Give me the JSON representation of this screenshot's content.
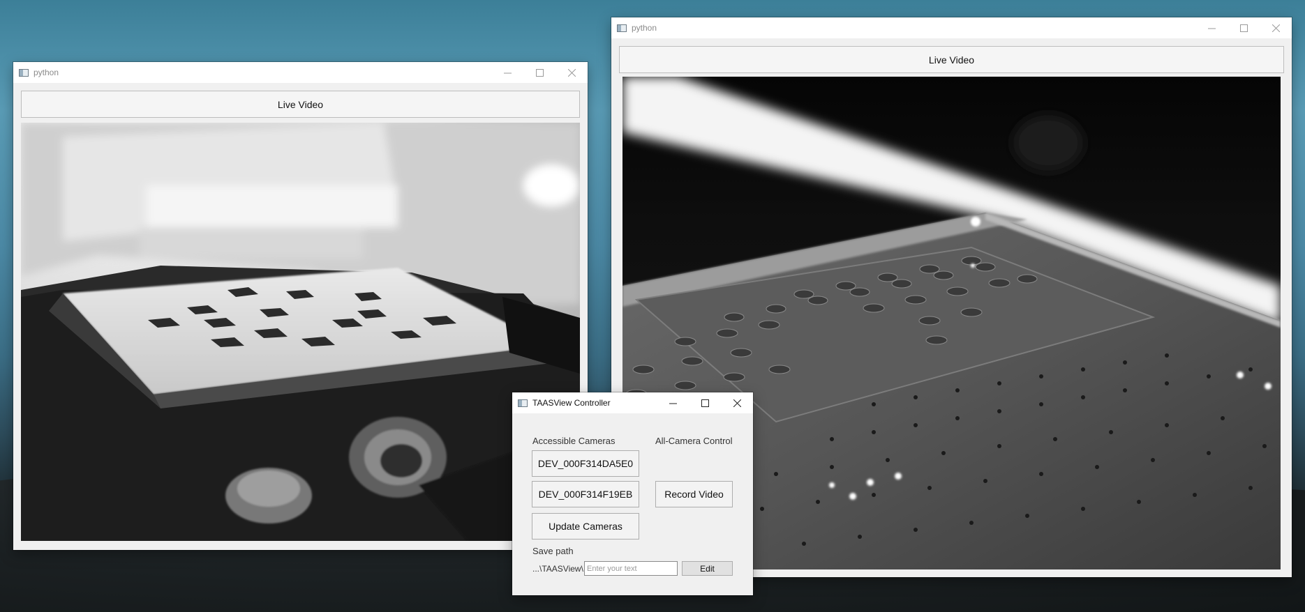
{
  "windows": {
    "left": {
      "title": "python",
      "live_label": "Live Video"
    },
    "right": {
      "title": "python",
      "live_label": "Live Video"
    },
    "controller": {
      "title": "TAASView Controller",
      "accessible_label": "Accessible Cameras",
      "all_control_label": "All-Camera Control",
      "cameras": [
        "DEV_000F314DA5E0",
        "DEV_000F314F19EB"
      ],
      "update_label": "Update Cameras",
      "record_label": "Record Video",
      "save_path_label": "Save path",
      "path_prefix": "...\\TAASView\\",
      "input_placeholder": "Enter your text",
      "edit_label": "Edit"
    }
  },
  "icons": {
    "minimize": "minimize-icon",
    "maximize": "maximize-icon",
    "close": "close-icon",
    "app": "python-app-icon"
  }
}
